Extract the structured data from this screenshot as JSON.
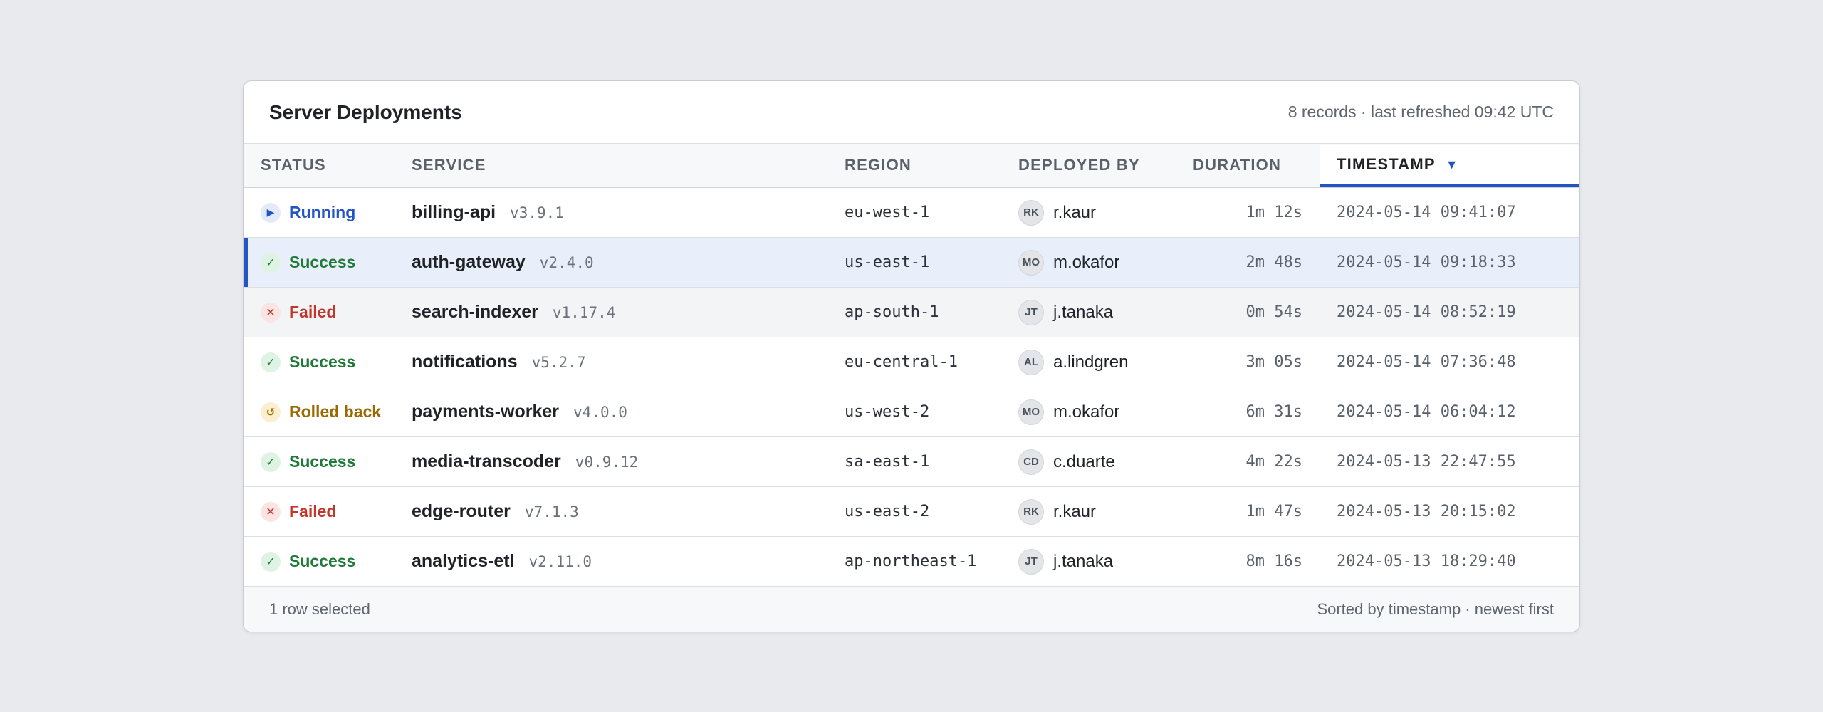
{
  "panel": {
    "title": "Server Deployments",
    "meta": "8 records · last refreshed 09:42 UTC"
  },
  "columns": {
    "status": "STATUS",
    "service": "SERVICE",
    "region": "REGION",
    "deployed_by": "DEPLOYED BY",
    "duration": "DURATION",
    "timestamp": "TIMESTAMP",
    "sort_indicator": "▼"
  },
  "rows": [
    {
      "status": "Running",
      "status_key": "running",
      "status_icon": "▶",
      "service": "billing-api",
      "version": "v3.9.1",
      "region": "eu-west-1",
      "initials": "RK",
      "user": "r.kaur",
      "duration": "1m 12s",
      "timestamp": "2024-05-14 09:41:07"
    },
    {
      "status": "Success",
      "status_key": "success",
      "status_icon": "✓",
      "service": "auth-gateway",
      "version": "v2.4.0",
      "region": "us-east-1",
      "initials": "MO",
      "user": "m.okafor",
      "duration": "2m 48s",
      "timestamp": "2024-05-14 09:18:33"
    },
    {
      "status": "Failed",
      "status_key": "failed",
      "status_icon": "✕",
      "service": "search-indexer",
      "version": "v1.17.4",
      "region": "ap-south-1",
      "initials": "JT",
      "user": "j.tanaka",
      "duration": "0m 54s",
      "timestamp": "2024-05-14 08:52:19"
    },
    {
      "status": "Success",
      "status_key": "success",
      "status_icon": "✓",
      "service": "notifications",
      "version": "v5.2.7",
      "region": "eu-central-1",
      "initials": "AL",
      "user": "a.lindgren",
      "duration": "3m 05s",
      "timestamp": "2024-05-14 07:36:48"
    },
    {
      "status": "Rolled back",
      "status_key": "rolled",
      "status_icon": "↺",
      "service": "payments-worker",
      "version": "v4.0.0",
      "region": "us-west-2",
      "initials": "MO",
      "user": "m.okafor",
      "duration": "6m 31s",
      "timestamp": "2024-05-14 06:04:12"
    },
    {
      "status": "Success",
      "status_key": "success",
      "status_icon": "✓",
      "service": "media-transcoder",
      "version": "v0.9.12",
      "region": "sa-east-1",
      "initials": "CD",
      "user": "c.duarte",
      "duration": "4m 22s",
      "timestamp": "2024-05-13 22:47:55"
    },
    {
      "status": "Failed",
      "status_key": "failed",
      "status_icon": "✕",
      "service": "edge-router",
      "version": "v7.1.3",
      "region": "us-east-2",
      "initials": "RK",
      "user": "r.kaur",
      "duration": "1m 47s",
      "timestamp": "2024-05-13 20:15:02"
    },
    {
      "status": "Success",
      "status_key": "success",
      "status_icon": "✓",
      "service": "analytics-etl",
      "version": "v2.11.0",
      "region": "ap-northeast-1",
      "initials": "JT",
      "user": "j.tanaka",
      "duration": "8m 16s",
      "timestamp": "2024-05-13 18:29:40"
    }
  ],
  "selection": {
    "selected_row": 1,
    "hovered_row": 2
  },
  "footer": {
    "selection_text": "1 row selected",
    "sort_text": "Sorted by timestamp · newest first"
  },
  "colors": {
    "accent": "#2354c4",
    "success": "#1e7a36",
    "failed": "#c2352b",
    "rolled_back": "#9a6a00",
    "running": "#2354c4"
  }
}
